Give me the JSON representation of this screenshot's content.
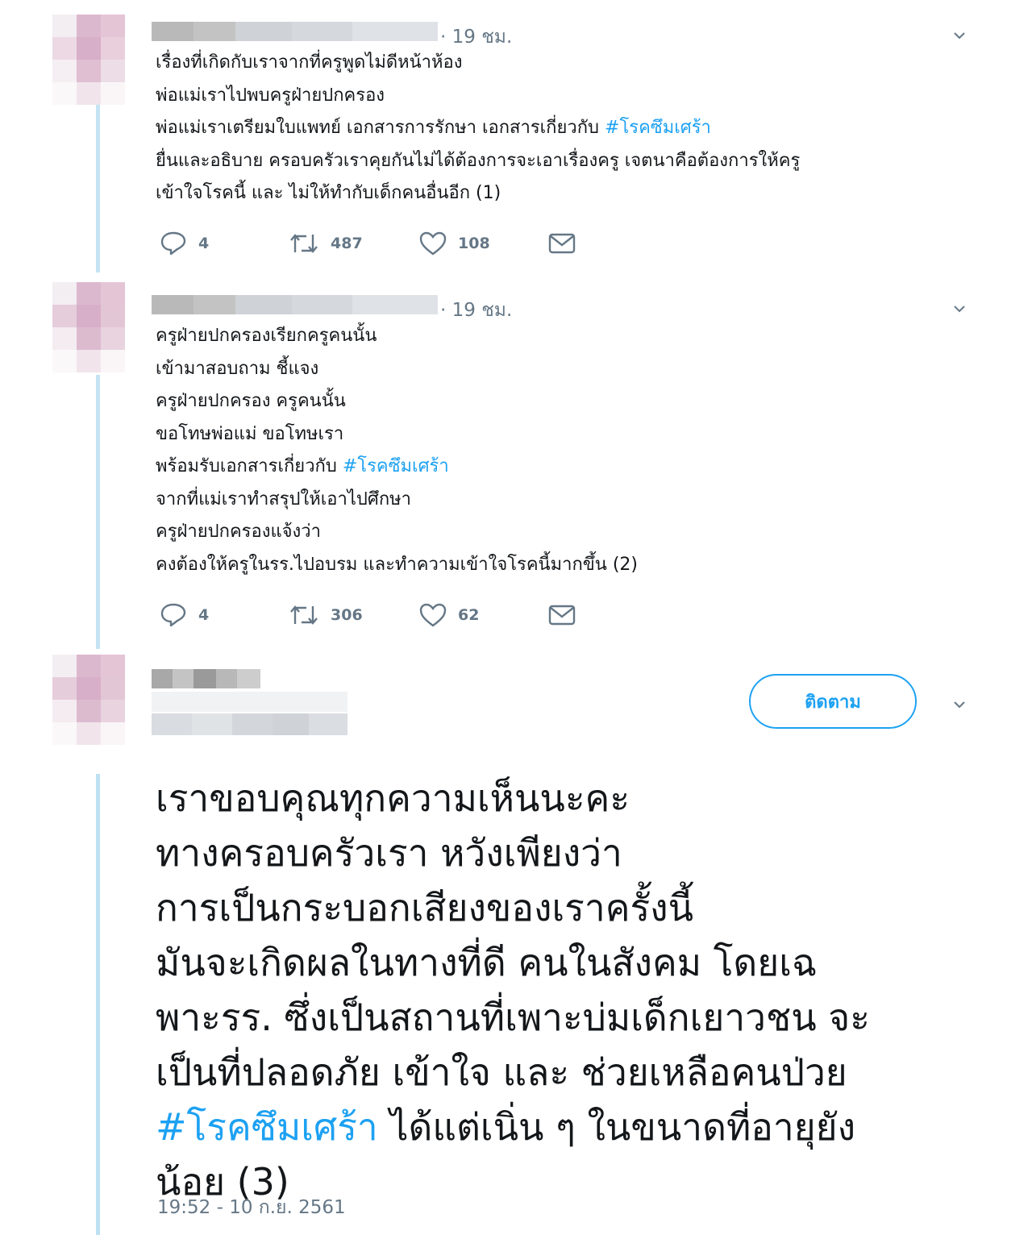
{
  "tweets": [
    {
      "time": "· 19 ชม.",
      "lines": [
        "เรื่องที่เกิดกับเราจากที่ครูพูดไม่ดีหน้าห้อง",
        "พ่อแม่เราไปพบครูฝ่ายปกครอง",
        "พ่อแม่เราเตรียมใบแพทย์ เอกสารการรักษา เอกสารเกี่ยวกับ ",
        "ยื่นและอธิบาย ครอบครัวเราคุยกันไม่ได้ต้องการจะเอาเรื่องครู เจตนาคือต้องการให้ครู",
        "เข้าใจโรคนี้ และ ไม่ให้ทำกับเด็กคนอื่นอีก (1)"
      ],
      "hashtag": "#โรคซึมเศร้า",
      "replies": "4",
      "retweets": "487",
      "likes": "108"
    },
    {
      "time": "· 19 ชม.",
      "lines": [
        "ครูฝ่ายปกครองเรียกครูคนนั้น",
        "เข้ามาสอบถาม ชี้แจง",
        "ครูฝ่ายปกครอง ครูคนนั้น",
        "ขอโทษพ่อแม่ ขอโทษเรา",
        "พร้อมรับเอกสารเกี่ยวกับ ",
        "จากที่แม่เราทำสรุปให้เอาไปศึกษา",
        "ครูฝ่ายปกครองแจ้งว่า",
        "คงต้องให้ครูในรร.ไปอบรม และทำความเข้าใจโรคนี้มากขึ้น (2)"
      ],
      "hashtag": "#โรคซึมเศร้า",
      "replies": "4",
      "retweets": "306",
      "likes": "62"
    }
  ],
  "main_tweet": {
    "follow_label": "ติดตาม",
    "lines": [
      "เราขอบคุณทุกความเห็นนะคะ",
      "ทางครอบครัวเรา หวังเพียงว่า",
      "การเป็นกระบอกเสียงของเราครั้งนี้",
      "มันจะเกิดผลในทางที่ดี คนในสังคม โดยเฉ",
      "พาะรร. ซึ่งเป็นสถานที่เพาะบ่มเด็กเยาวชน จะ",
      "เป็นที่ปลอดภัย เข้าใจ และ ช่วยเหลือคนป่วย",
      " ได้แต่เนิ่น ๆ ในขนาดที่อายุยัง",
      "น้อย (3)"
    ],
    "hashtag": "#โรคซึมเศร้า",
    "timestamp": "19:52 - 10 ก.ย. 2561"
  },
  "icons": {
    "reply": "reply-icon",
    "retweet": "retweet-icon",
    "like": "heart-icon",
    "dm": "envelope-icon",
    "menu": "chevron-down-icon"
  },
  "colors": {
    "link": "#1da1f2",
    "muted": "#657786",
    "thread": "#c4e4f4"
  }
}
